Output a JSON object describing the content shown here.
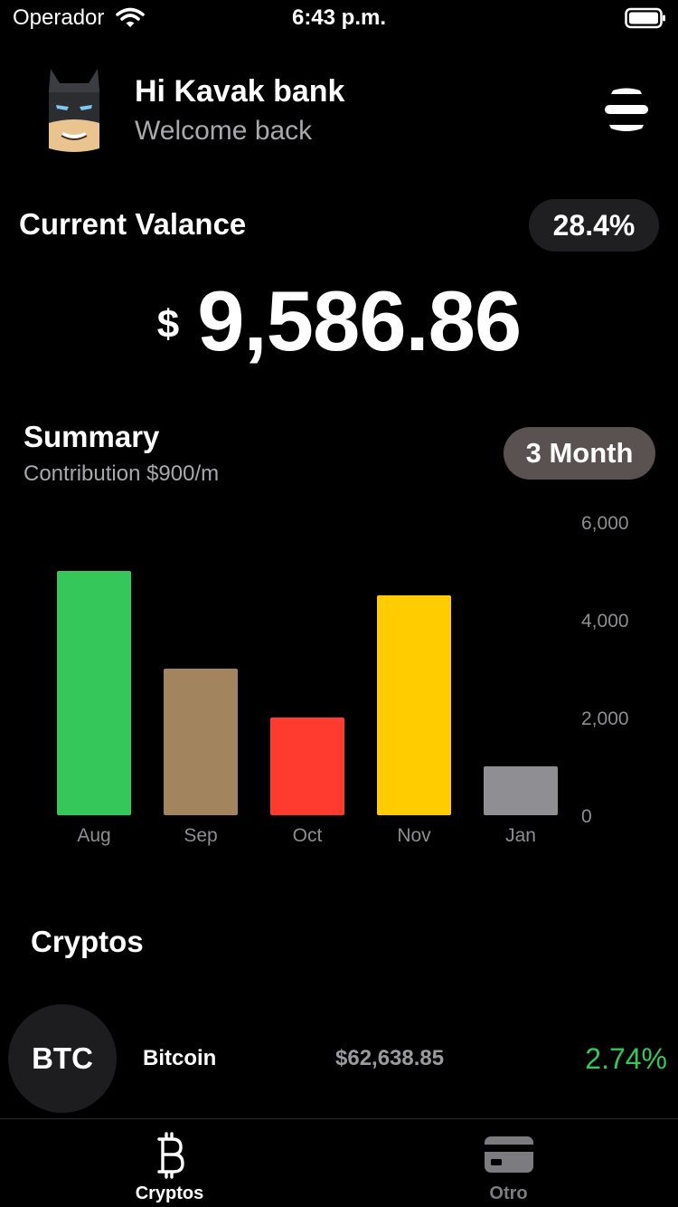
{
  "status_bar": {
    "carrier": "Operador",
    "time": "6:43 p.m."
  },
  "header": {
    "greeting": "Hi Kavak bank",
    "subtitle": "Welcome back"
  },
  "balance": {
    "label": "Current Valance",
    "change_badge": "28.4%",
    "currency_symbol": "$",
    "amount": "9,586.86"
  },
  "summary": {
    "title": "Summary",
    "subtitle": "Contribution $900/m",
    "period_button": "3 Month"
  },
  "chart_data": {
    "type": "bar",
    "categories": [
      "Aug",
      "Sep",
      "Oct",
      "Nov",
      "Jan"
    ],
    "values": [
      5000,
      3000,
      2000,
      4500,
      1000
    ],
    "colors": [
      "#35c759",
      "#a2845e",
      "#ff3b30",
      "#ffcc00",
      "#8e8e93"
    ],
    "ylim": [
      0,
      6000
    ],
    "yticks": [
      "0",
      "2,000",
      "4,000",
      "6,000"
    ],
    "ytick_values": [
      0,
      2000,
      4000,
      6000
    ],
    "y_axis_side": "right",
    "grid": false
  },
  "cryptos": {
    "title": "Cryptos",
    "items": [
      {
        "symbol": "BTC",
        "name": "Bitcoin",
        "price": "$62,638.85",
        "change": "2.74%",
        "change_color": "#35c759"
      }
    ]
  },
  "tab_bar": {
    "tabs": [
      {
        "label": "Cryptos",
        "icon": "bitcoin-icon",
        "active": true
      },
      {
        "label": "Otro",
        "icon": "credit-card-icon",
        "active": false
      }
    ]
  }
}
